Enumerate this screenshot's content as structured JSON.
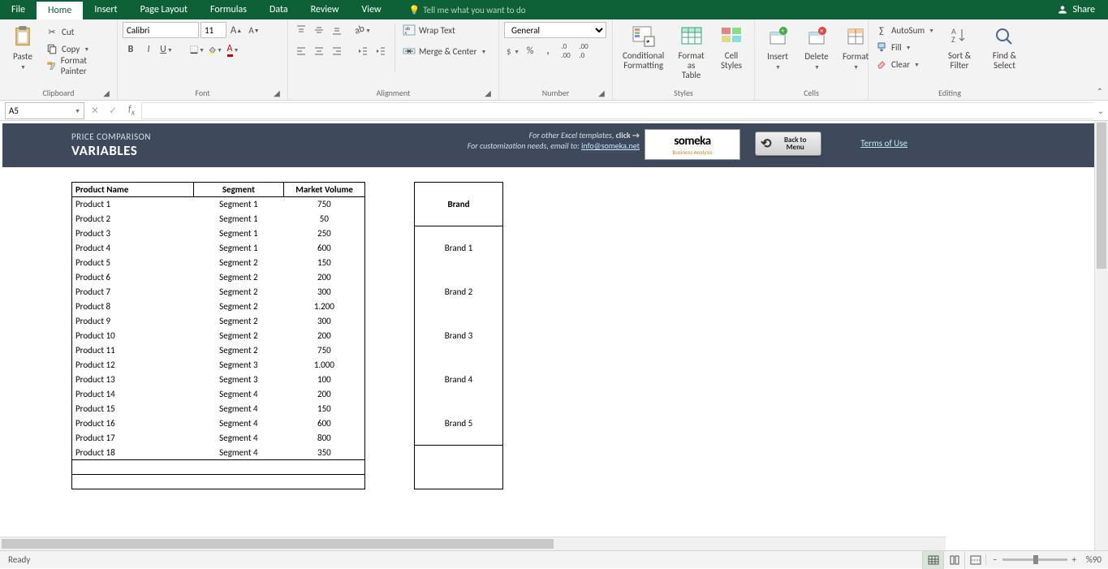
{
  "title_tabs": [
    "File",
    "Home",
    "Insert",
    "Page Layout",
    "Formulas",
    "Data",
    "Review",
    "View"
  ],
  "active_tab": "Home",
  "tell_me": "Tell me what you want to do",
  "share": "Share",
  "ribbon": {
    "clipboard": {
      "label": "Clipboard",
      "paste": "Paste",
      "cut": "Cut",
      "copy": "Copy",
      "format_painter": "Format Painter"
    },
    "font": {
      "label": "Font",
      "name": "Calibri",
      "size": "11"
    },
    "alignment": {
      "label": "Alignment",
      "wrap": "Wrap Text",
      "merge": "Merge & Center"
    },
    "number": {
      "label": "Number",
      "format": "General"
    },
    "styles": {
      "label": "Styles",
      "cond": "Conditional Formatting",
      "fmt_table": "Format as Table",
      "cell": "Cell Styles"
    },
    "cells": {
      "label": "Cells",
      "insert": "Insert",
      "delete": "Delete",
      "format": "Format"
    },
    "editing": {
      "label": "Editing",
      "autosum": "AutoSum",
      "fill": "Fill",
      "clear": "Clear",
      "sort": "Sort & Filter",
      "find": "Find & Select"
    }
  },
  "name_box": "A5",
  "template": {
    "subtitle": "PRICE COMPARISON",
    "title": "VARIABLES",
    "link1": "For other Excel templates,",
    "link1b": "click →",
    "link2": "For customization needs, email to:",
    "email": "info@someka.net",
    "logo_top": "someka",
    "logo_sub": "Business Analysis",
    "back": "Back to Menu",
    "terms": "Terms of Use"
  },
  "products": {
    "headers": [
      "Product Name",
      "Segment",
      "Market Volume"
    ],
    "rows": [
      [
        "Product 1",
        "Segment 1",
        "750"
      ],
      [
        "Product 2",
        "Segment 1",
        "50"
      ],
      [
        "Product 3",
        "Segment 1",
        "250"
      ],
      [
        "Product 4",
        "Segment 1",
        "600"
      ],
      [
        "Product 5",
        "Segment 2",
        "150"
      ],
      [
        "Product 6",
        "Segment 2",
        "200"
      ],
      [
        "Product 7",
        "Segment 2",
        "300"
      ],
      [
        "Product 8",
        "Segment 2",
        "1.200"
      ],
      [
        "Product 9",
        "Segment 2",
        "300"
      ],
      [
        "Product 10",
        "Segment 2",
        "200"
      ],
      [
        "Product 11",
        "Segment 2",
        "750"
      ],
      [
        "Product 12",
        "Segment 3",
        "1.000"
      ],
      [
        "Product 13",
        "Segment 3",
        "100"
      ],
      [
        "Product 14",
        "Segment 4",
        "200"
      ],
      [
        "Product 15",
        "Segment 4",
        "150"
      ],
      [
        "Product 16",
        "Segment 4",
        "600"
      ],
      [
        "Product 17",
        "Segment 4",
        "800"
      ],
      [
        "Product 18",
        "Segment 4",
        "350"
      ]
    ]
  },
  "brands": {
    "header": "Brand",
    "rows": [
      "Brand 1",
      "Brand 2",
      "Brand 3",
      "Brand 4",
      "Brand 5"
    ]
  },
  "status": {
    "ready": "Ready",
    "zoom": "%90"
  }
}
